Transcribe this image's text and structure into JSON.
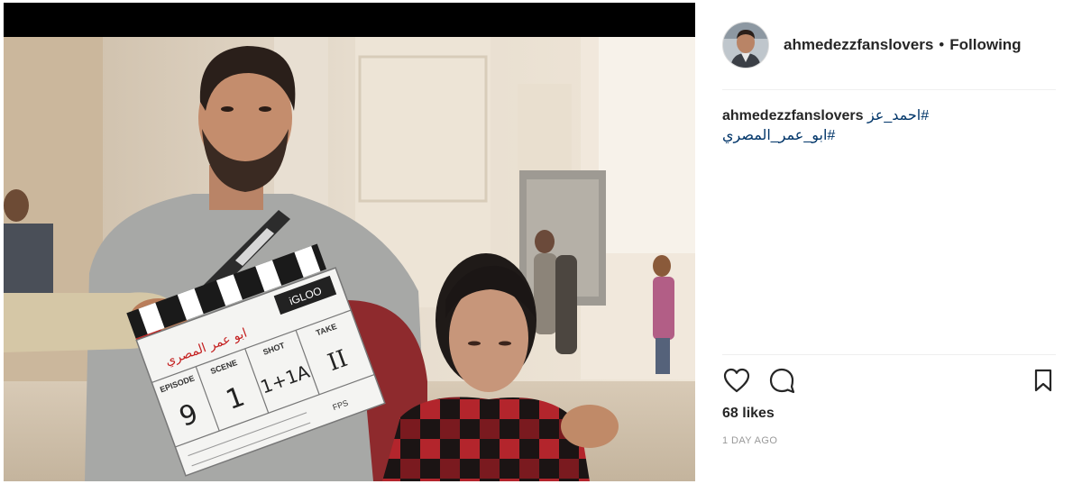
{
  "post": {
    "username": "ahmedezzfanslovers",
    "separator": "•",
    "follow_status": "Following",
    "caption": {
      "username": "ahmedezzfanslovers",
      "hashtag_1": "#احمد_عز",
      "hashtag_2": "#ابو_عمر_المصري"
    },
    "likes": "68 likes",
    "timestamp": "1 DAY AGO",
    "clapperboard": {
      "brand": "iGLOO",
      "title": "ابو عمر المصري",
      "episode_label": "EPISODE",
      "episode_value": "9",
      "scene_label": "SCENE",
      "scene_value": "1",
      "shot_label": "SHOT",
      "shot_value": "1+1A",
      "take_label": "TAKE",
      "take_value": "II",
      "fps_label": "FPS"
    }
  },
  "icons": {
    "like": "heart-icon",
    "comment": "comment-icon",
    "save": "bookmark-icon"
  }
}
